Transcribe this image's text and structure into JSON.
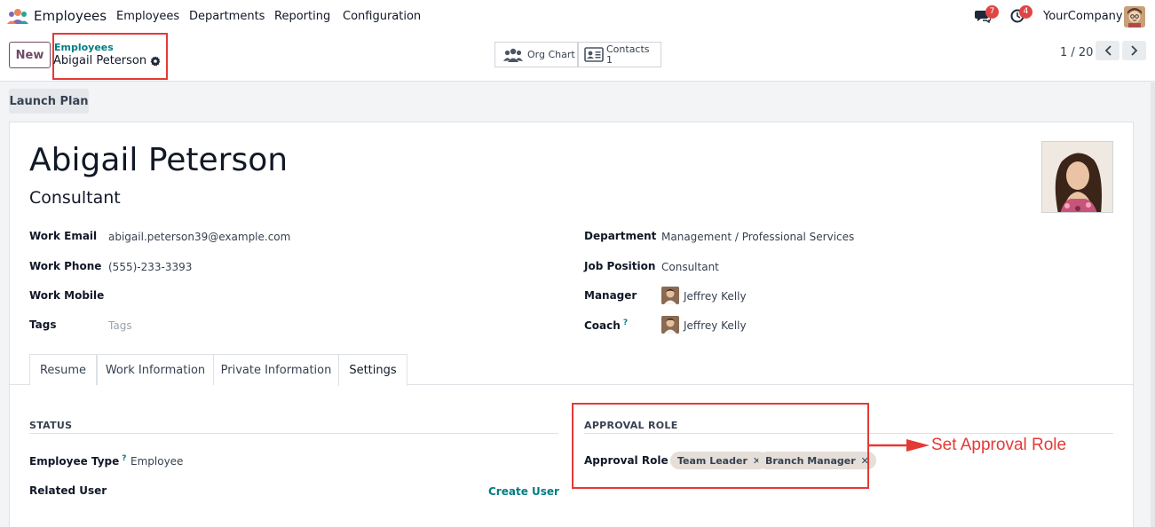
{
  "nav": {
    "app_name": "Employees",
    "menu": [
      "Employees",
      "Departments",
      "Reporting",
      "Configuration"
    ],
    "chat_badge": "7",
    "activity_badge": "4",
    "company": "YourCompany"
  },
  "control": {
    "new_label": "New",
    "breadcrumb_parent": "Employees",
    "breadcrumb_current": "Abigail Peterson",
    "org_chart_label": "Org Chart",
    "contacts_label": "Contacts",
    "contacts_count": "1",
    "pager": "1 / 20"
  },
  "launch_plan_label": "Launch Plan",
  "employee": {
    "name": "Abigail Peterson",
    "job_title": "Consultant",
    "fields_left": [
      {
        "label": "Work Email",
        "value": "abigail.peterson39@example.com"
      },
      {
        "label": "Work Phone",
        "value": "(555)-233-3393"
      },
      {
        "label": "Work Mobile",
        "value": ""
      },
      {
        "label": "Tags",
        "placeholder": "Tags"
      }
    ],
    "fields_right": [
      {
        "label": "Department",
        "value": "Management / Professional Services"
      },
      {
        "label": "Job Position",
        "value": "Consultant"
      },
      {
        "label": "Manager",
        "value": "Jeffrey Kelly"
      },
      {
        "label": "Coach",
        "value": "Jeffrey Kelly",
        "help": "?"
      }
    ]
  },
  "tabs": [
    "Resume",
    "Work Information",
    "Private Information",
    "Settings"
  ],
  "settings": {
    "status_title": "STATUS",
    "employee_type_label": "Employee Type",
    "employee_type_help": "?",
    "employee_type_value": "Employee",
    "related_user_label": "Related User",
    "create_user_label": "Create User",
    "approval_title": "APPROVAL ROLE",
    "approval_label": "Approval Role",
    "approval_tags": [
      "Team Leader",
      "Branch Manager"
    ]
  },
  "annotation": {
    "text": "Set Approval Role",
    "color": "#e53935"
  },
  "colors": {
    "brand": "#714b67",
    "link": "#017e84",
    "badge": "#e04545"
  }
}
